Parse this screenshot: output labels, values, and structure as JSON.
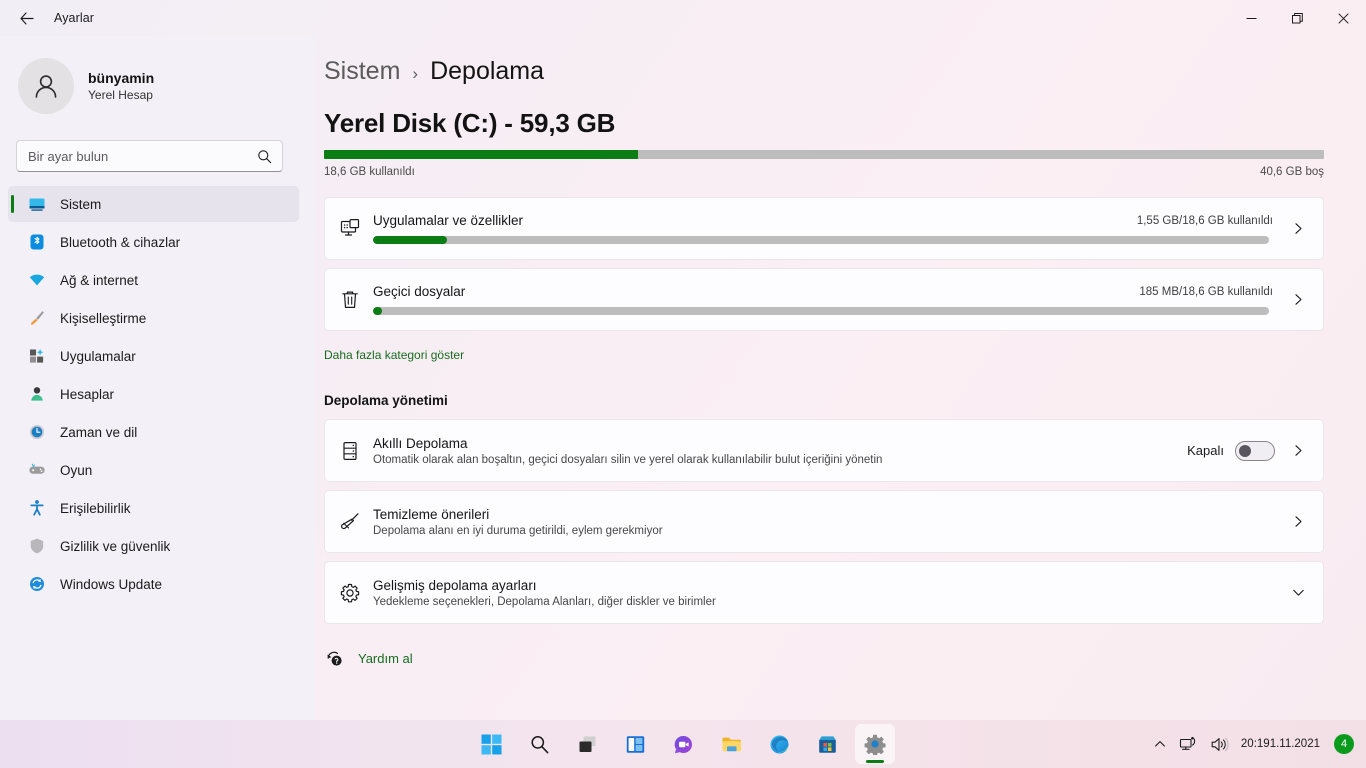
{
  "window": {
    "app_title": "Ayarlar",
    "back_icon": "back-arrow-icon",
    "minimize_label": "–",
    "maximize_label": "❐",
    "close_label": "✕"
  },
  "sidebar": {
    "account": {
      "name": "bünyamin",
      "subtitle": "Yerel Hesap",
      "avatar_icon": "person-avatar-icon"
    },
    "search": {
      "placeholder": "Bir ayar bulun",
      "value": "",
      "icon": "search-icon"
    },
    "items": [
      {
        "label": "Sistem",
        "icon": "monitor-icon",
        "active": true
      },
      {
        "label": "Bluetooth & cihazlar",
        "icon": "bluetooth-icon",
        "active": false
      },
      {
        "label": "Ağ & internet",
        "icon": "wifi-icon",
        "active": false
      },
      {
        "label": "Kişiselleştirme",
        "icon": "paintbrush-icon",
        "active": false
      },
      {
        "label": "Uygulamalar",
        "icon": "apps-icon",
        "active": false
      },
      {
        "label": "Hesaplar",
        "icon": "account-icon",
        "active": false
      },
      {
        "label": "Zaman ve dil",
        "icon": "clock-icon",
        "active": false
      },
      {
        "label": "Oyun",
        "icon": "gamepad-icon",
        "active": false
      },
      {
        "label": "Erişilebilirlik",
        "icon": "accessibility-icon",
        "active": false
      },
      {
        "label": "Gizlilik ve güvenlik",
        "icon": "shield-icon",
        "active": false
      },
      {
        "label": "Windows Update",
        "icon": "update-icon",
        "active": false
      }
    ]
  },
  "main": {
    "breadcrumb": {
      "parent": "Sistem",
      "separator": "›",
      "current": "Depolama"
    },
    "disk": {
      "title": "Yerel Disk (C:) - 59,3 GB",
      "used_label": "18,6 GB kullanıldı",
      "free_label": "40,6 GB boş",
      "used_percent": 31.4
    },
    "categories": [
      {
        "title": "Uygulamalar ve özellikler",
        "usage": "1,55 GB/18,6 GB kullanıldı",
        "percent": 8.3,
        "icon": "apps-monitor-icon",
        "chevron": "chevron-right-icon"
      },
      {
        "title": "Geçici dosyalar",
        "usage": "185 MB/18,6 GB kullanıldı",
        "percent": 1.0,
        "icon": "trash-icon",
        "chevron": "chevron-right-icon"
      }
    ],
    "show_more_link": "Daha fazla kategori göster",
    "management_heading": "Depolama yönetimi",
    "management": [
      {
        "title": "Akıllı Depolama",
        "subtitle": "Otomatik olarak alan boşaltın, geçici dosyaları silin ve yerel olarak kullanılabilir bulut içeriğini yönetin",
        "icon": "storage-drive-icon",
        "toggle_label": "Kapalı",
        "toggle_on": false,
        "chevron": "chevron-right-icon"
      },
      {
        "title": "Temizleme önerileri",
        "subtitle": "Depolama alanı en iyi duruma getirildi, eylem gerekmiyor",
        "icon": "broom-icon",
        "chevron": "chevron-right-icon"
      },
      {
        "title": "Gelişmiş depolama ayarları",
        "subtitle": "Yedekleme seçenekleri, Depolama Alanları, diğer diskler ve birimler",
        "icon": "gear-icon",
        "chevron": "chevron-down-icon"
      }
    ],
    "help": {
      "label": "Yardım al",
      "icon": "help-question-icon"
    }
  },
  "taskbar": {
    "buttons": [
      {
        "name": "start",
        "icon": "windows-start-icon",
        "active": false
      },
      {
        "name": "search",
        "icon": "search-icon",
        "active": false
      },
      {
        "name": "task-view",
        "icon": "task-view-icon",
        "active": false
      },
      {
        "name": "widgets",
        "icon": "widgets-icon",
        "active": false
      },
      {
        "name": "chat",
        "icon": "chat-icon",
        "active": false
      },
      {
        "name": "file-explorer",
        "icon": "folder-icon",
        "active": false
      },
      {
        "name": "edge",
        "icon": "edge-icon",
        "active": false
      },
      {
        "name": "store",
        "icon": "store-icon",
        "active": false
      },
      {
        "name": "settings",
        "icon": "gear-icon",
        "active": true
      }
    ],
    "tray": {
      "chevron_icon": "chevron-up-icon",
      "network_icon": "network-icon",
      "volume_icon": "volume-icon",
      "time": "20:19",
      "date": "1.11.2021",
      "badge_count": "4"
    }
  },
  "colors": {
    "accent_green": "#0b7d14",
    "link_green": "#176b1f",
    "bar_track": "#bdbdbd",
    "card_bg": "#fdfcfe",
    "sidebar_bg": "#f3f0f7"
  }
}
